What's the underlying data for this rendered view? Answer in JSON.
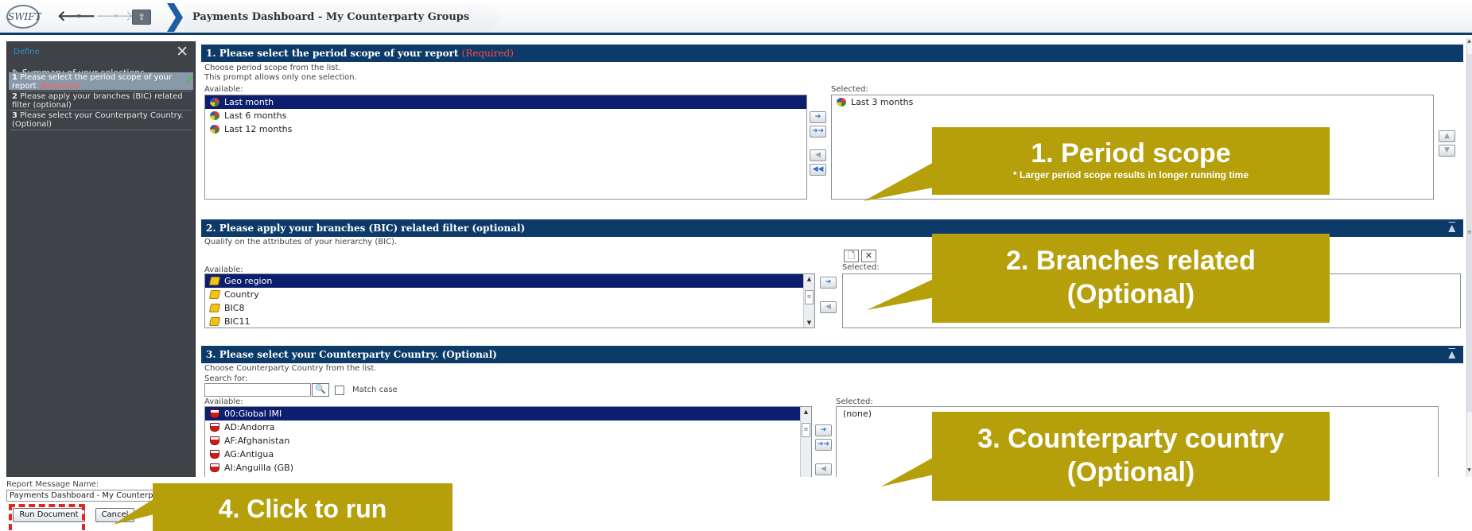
{
  "nav": {
    "logo_text": "SWIFT",
    "back_arrow": "🡐",
    "forward_arrow": "🡒",
    "dropdown_caret": "▾",
    "home_glyph": "⇧",
    "breadcrumb": "Payments Dashboard - My Counterparty Groups"
  },
  "sidebar": {
    "title": "Define",
    "close_glyph": "✕",
    "summary_icon": "✎",
    "summary": "Summary of your selections",
    "items": [
      {
        "num": "1",
        "label": "Please select the period scope of your report",
        "required": "(Required)",
        "check": "✔"
      },
      {
        "num": "2",
        "label": "Please apply your branches (BIC) related filter (optional)"
      },
      {
        "num": "3",
        "label": "Please select your Counterparty Country. (Optional)"
      }
    ]
  },
  "prompt1": {
    "title": "1. Please select the period scope of your report",
    "required": "(Required)",
    "desc1": "Choose period scope from the list.",
    "desc2": "This prompt allows only one selection.",
    "available_label": "Available:",
    "selected_label": "Selected:",
    "available": [
      "Last month",
      "Last 6 months",
      "Last 12 months"
    ],
    "selected": [
      "Last 3 months"
    ]
  },
  "prompt2": {
    "title": "2. Please apply your branches (BIC) related filter (optional)",
    "desc": "Qualify on the attributes of your hierarchy (BIC).",
    "available_label": "Available:",
    "selected_label": "Selected:",
    "available": [
      "Geo region",
      "Country",
      "BIC8",
      "BIC11"
    ]
  },
  "prompt3": {
    "title": "3. Please select your Counterparty Country. (Optional)",
    "desc": "Choose Counterparty Country from the list.",
    "search_label": "Search for:",
    "search_value": "",
    "match_case": "Match case",
    "available_label": "Available:",
    "selected_label": "Selected:",
    "available": [
      "00:Global IMI",
      "AD:Andorra",
      "AF:Afghanistan",
      "AG:Antigua",
      "AI:Anguilla (GB)"
    ],
    "selected": [
      "(none)"
    ]
  },
  "glyphs": {
    "add": "➔",
    "add_all": "➔➔",
    "remove": "◀",
    "remove_all": "◀◀",
    "move_up": "▲",
    "move_down": "▼",
    "collapse": "▲",
    "new_doc": "🗋",
    "clear": "✕",
    "search": "🔍",
    "grip": "≡"
  },
  "footer": {
    "rmn_label": "Report Message Name:",
    "rmn_value": "Payments Dashboard - My Counterparty Groups",
    "run": "Run Document",
    "cancel": "Cancel"
  },
  "callouts": {
    "c1_title": "1.    Period scope",
    "c1_note": "* Larger period scope results in longer running time",
    "c2_line1": "2. Branches related",
    "c2_line2": "(Optional)",
    "c3_line1": "3. Counterparty country",
    "c3_line2": "(Optional)",
    "c4": "4. Click to run"
  },
  "colors": {
    "header_navy": "#0c3b6a",
    "selected_row": "#0c1f6e",
    "callout_olive": "#b5a00c",
    "required_red": "#ff4a4a",
    "highlight_red": "#e52424"
  }
}
